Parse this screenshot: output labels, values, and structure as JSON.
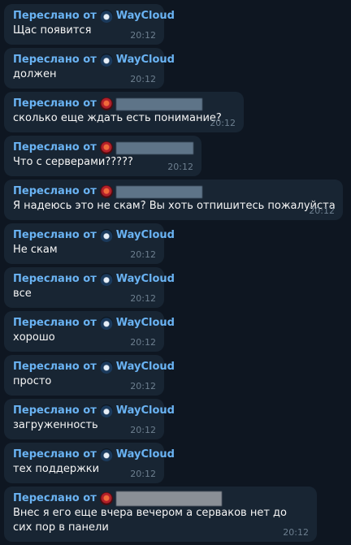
{
  "messages": [
    {
      "forwarded_prefix": "Переслано от",
      "sender": "WayCloud",
      "avatar": "waycloud-logo-icon",
      "text": "Щас появится",
      "time": "20:12"
    },
    {
      "forwarded_prefix": "Переслано от",
      "sender": "WayCloud",
      "avatar": "waycloud-logo-icon",
      "text": "должен",
      "time": "20:12"
    },
    {
      "forwarded_prefix": "Переслано от",
      "sender": "",
      "avatar": "red-avatar-icon",
      "text": "сколько еще ждать есть понимание?",
      "time": "20:12"
    },
    {
      "forwarded_prefix": "Переслано от",
      "sender": "",
      "avatar": "red-avatar-icon",
      "text": "Что с серверами?????",
      "time": "20:12"
    },
    {
      "forwarded_prefix": "Переслано от",
      "sender": "",
      "avatar": "red-avatar-icon",
      "text": "Я надеюсь это не скам? Вы хоть отпишитесь пожалуйста",
      "time": "20:12"
    },
    {
      "forwarded_prefix": "Переслано от",
      "sender": "WayCloud",
      "avatar": "waycloud-logo-icon",
      "text": "Не скам",
      "time": "20:12"
    },
    {
      "forwarded_prefix": "Переслано от",
      "sender": "WayCloud",
      "avatar": "waycloud-logo-icon",
      "text": "все",
      "time": "20:12"
    },
    {
      "forwarded_prefix": "Переслано от",
      "sender": "WayCloud",
      "avatar": "waycloud-logo-icon",
      "text": "хорошо",
      "time": "20:12"
    },
    {
      "forwarded_prefix": "Переслано от",
      "sender": "WayCloud",
      "avatar": "waycloud-logo-icon",
      "text": "просто",
      "time": "20:12"
    },
    {
      "forwarded_prefix": "Переслано от",
      "sender": "WayCloud",
      "avatar": "waycloud-logo-icon",
      "text": "загруженность",
      "time": "20:12"
    },
    {
      "forwarded_prefix": "Переслано от",
      "sender": "WayCloud",
      "avatar": "waycloud-logo-icon",
      "text": "тех поддержки",
      "time": "20:12"
    },
    {
      "forwarded_prefix": "Переслано от",
      "sender": "",
      "avatar": "red-avatar-icon",
      "text": "Внес я его еще вчера вечером а серваков нет до сих пор в панели",
      "time": "20:12"
    }
  ],
  "colors": {
    "background": "#0e1621",
    "bubble": "#182533",
    "forward_header": "#6ab3f3",
    "message_text": "#f5f5f5",
    "timestamp": "#6d7f8f"
  }
}
